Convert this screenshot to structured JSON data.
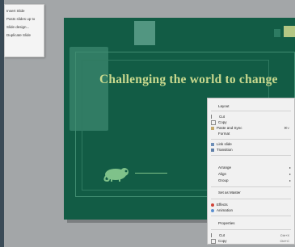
{
  "tooltip": {
    "lines": [
      "Insert Slide",
      "Pasts slides up to",
      "Slide design...",
      "Duplicate Slide"
    ]
  },
  "slide": {
    "title": "Challenging the world to change"
  },
  "menu": {
    "items": [
      {
        "label": "Layout",
        "icon": "layout-icon"
      },
      {
        "label": "Cut",
        "icon": "cut-icon"
      },
      {
        "label": "Copy",
        "icon": "copy-icon"
      },
      {
        "label": "Paste and Sync",
        "icon": "paste-icon",
        "shortcut": "⌘V"
      },
      {
        "label": "Format",
        "icon": ""
      },
      {
        "label": "Link slide",
        "icon": "link-icon"
      },
      {
        "label": "Transition",
        "icon": "transition-icon"
      },
      {
        "label": "Arrange",
        "icon": "",
        "submenu": true
      },
      {
        "label": "Align",
        "icon": "",
        "submenu": true
      },
      {
        "label": "Group",
        "icon": "",
        "submenu": true
      },
      {
        "label": "Set as Master",
        "icon": ""
      },
      {
        "label": "Effects",
        "icon": "effects-icon"
      },
      {
        "label": "Animation",
        "icon": "animation-icon"
      },
      {
        "label": "Properties",
        "icon": ""
      },
      {
        "label": "Cut",
        "icon": "cut-icon",
        "shortcut": "Ctrl+X"
      },
      {
        "label": "Copy",
        "icon": "copy-icon",
        "shortcut": "Ctrl+C"
      }
    ]
  },
  "colors": {
    "slide_bg": "#125c45",
    "title": "#c9d98e",
    "workspace": "#a3a6a8"
  }
}
